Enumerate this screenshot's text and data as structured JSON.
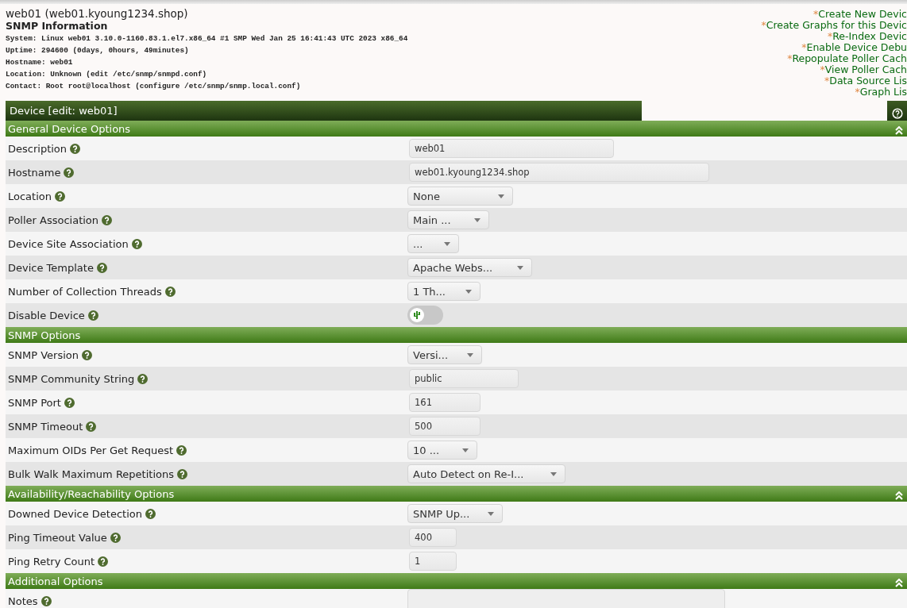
{
  "header": {
    "title": "web01 (web01.kyoung1234.shop)",
    "subtitle": "SNMP Information",
    "info_lines": [
      "System: Linux web01 3.10.0-1160.83.1.el7.x86_64 #1 SMP Wed Jan 25 16:41:43 UTC 2023 x86_64",
      "Uptime: 294600 (0days, 0hours, 49minutes)",
      "Hostname: web01",
      "Location: Unknown (edit /etc/snmp/snmpd.conf)",
      "Contact: Root root@localhost (configure /etc/snmp/snmp.local.conf)"
    ]
  },
  "actions": [
    {
      "marker": "*",
      "label": "Create New Devic"
    },
    {
      "marker": "*",
      "label": "Create Graphs for this Devic"
    },
    {
      "marker": "*",
      "label": "Re-Index Devic"
    },
    {
      "marker": "*",
      "label": "Enable Device Debu"
    },
    {
      "marker": "*",
      "label": "Repopulate Poller Cach"
    },
    {
      "marker": "*",
      "label": "View Poller Cach"
    },
    {
      "marker": "*",
      "label": "Data Source Lis"
    },
    {
      "marker": "*",
      "label": "Graph Lis"
    }
  ],
  "panel": {
    "title": "Device [edit: web01]"
  },
  "sections": [
    {
      "title": "General Device Options",
      "collapsible": true,
      "fields": [
        {
          "label": "Description",
          "kind": "text",
          "value": "web01"
        },
        {
          "label": "Hostname",
          "kind": "text",
          "value": "web01.kyoung1234.shop"
        },
        {
          "label": "Location",
          "kind": "select",
          "value": "None"
        },
        {
          "label": "Poller Association",
          "kind": "select",
          "value": "Main ..."
        },
        {
          "label": "Device Site Association",
          "kind": "select",
          "value": "..."
        },
        {
          "label": "Device Template",
          "kind": "select",
          "value": "Apache Webs..."
        },
        {
          "label": "Number of Collection Threads",
          "kind": "select",
          "value": "1 Th..."
        },
        {
          "label": "Disable Device",
          "kind": "toggle",
          "on": false
        }
      ]
    },
    {
      "title": "SNMP Options",
      "collapsible": false,
      "fields": [
        {
          "label": "SNMP Version",
          "kind": "select",
          "value": "Versi..."
        },
        {
          "label": "SNMP Community String",
          "kind": "text",
          "value": "public"
        },
        {
          "label": "SNMP Port",
          "kind": "text",
          "value": "161"
        },
        {
          "label": "SNMP Timeout",
          "kind": "text",
          "value": "500"
        },
        {
          "label": "Maximum OIDs Per Get Request",
          "kind": "select",
          "value": "10 ..."
        },
        {
          "label": "Bulk Walk Maximum Repetitions",
          "kind": "select",
          "value": "Auto Detect on Re-I..."
        }
      ]
    },
    {
      "title": "Availability/Reachability Options",
      "collapsible": true,
      "fields": [
        {
          "label": "Downed Device Detection",
          "kind": "select",
          "value": "SNMP Up..."
        },
        {
          "label": "Ping Timeout Value",
          "kind": "text",
          "value": "400"
        },
        {
          "label": "Ping Retry Count",
          "kind": "text",
          "value": "1"
        }
      ]
    },
    {
      "title": "Additional Options",
      "collapsible": true,
      "fields": [
        {
          "label": "Notes",
          "kind": "textarea"
        }
      ]
    }
  ]
}
